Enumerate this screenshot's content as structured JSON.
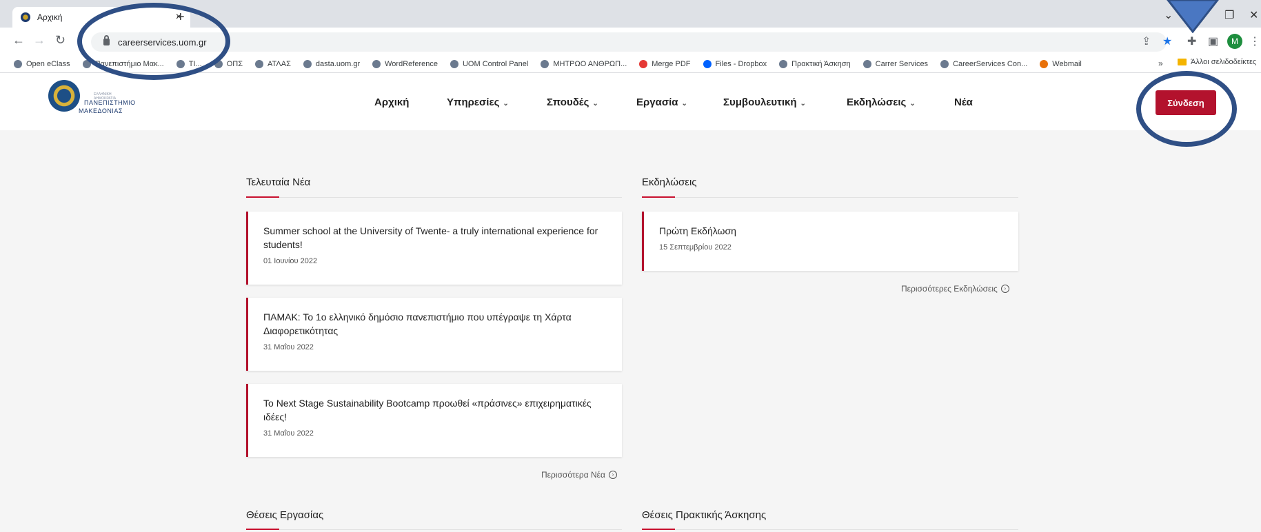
{
  "browser": {
    "tab_title": "Αρχική",
    "tab_close": "×",
    "new_tab": "+",
    "url": "careerservices.uom.gr",
    "avatar_letter": "M",
    "bookmarks": [
      "Open eClass",
      "Πανεπιστήμιο Μακ...",
      "ΤΙ...",
      "ΟΠΣ",
      "ΑΤΛΑΣ",
      "dasta.uom.gr",
      "WordReference",
      "UOM Control Panel",
      "ΜΗΤΡΩΟ ΑΝΘΡΩΠ...",
      "Merge PDF",
      "Files - Dropbox",
      "Πρακτική Άσκηση",
      "Carrer Services",
      "CareerServices Con...",
      "Webmail"
    ],
    "bookmarks_more": "»",
    "other_bookmarks": "Άλλοι σελιδοδείκτες"
  },
  "site": {
    "logo_line0": "ΕΛΛΗΝΙΚΗ ΔΗΜΟΚΡΑΤΙΑ",
    "logo_line1": "ΠΑΝΕΠΙΣΤΗΜΙΟ",
    "logo_line2": "ΜΑΚΕΔΟΝΙΑΣ",
    "nav": {
      "home": "Αρχική",
      "services": "Υπηρεσίες",
      "studies": "Σπουδές",
      "work": "Εργασία",
      "counseling": "Συμβουλευτική",
      "events": "Εκδηλώσεις",
      "news": "Νέα"
    },
    "login": "Σύνδεση"
  },
  "news": {
    "title": "Τελευταία Νέα",
    "items": [
      {
        "title": "Summer school at the University of Twente- a truly international experience for students!",
        "date": "01 Ιουνίου 2022"
      },
      {
        "title": "ΠΑΜΑΚ: Το 1ο ελληνικό δημόσιο πανεπιστήμιο που υπέγραψε τη Χάρτα Διαφορετικότητας",
        "date": "31 Μαΐου 2022"
      },
      {
        "title": "Το Next Stage Sustainability Bootcamp προωθεί «πράσινες» επιχειρηματικές ιδέες!",
        "date": "31 Μαΐου 2022"
      }
    ],
    "more": "Περισσότερα Νέα"
  },
  "events": {
    "title": "Εκδηλώσεις",
    "items": [
      {
        "title": "Πρώτη Εκδήλωση",
        "date": "15 Σεπτεμβρίου 2022"
      }
    ],
    "more": "Περισσότερες Εκδηλώσεις"
  },
  "jobs": {
    "title": "Θέσεις Εργασίας"
  },
  "internships": {
    "title": "Θέσεις Πρακτικής Άσκησης"
  },
  "colors": {
    "accent": "#b3122d",
    "annotation": "#2f4f85"
  }
}
